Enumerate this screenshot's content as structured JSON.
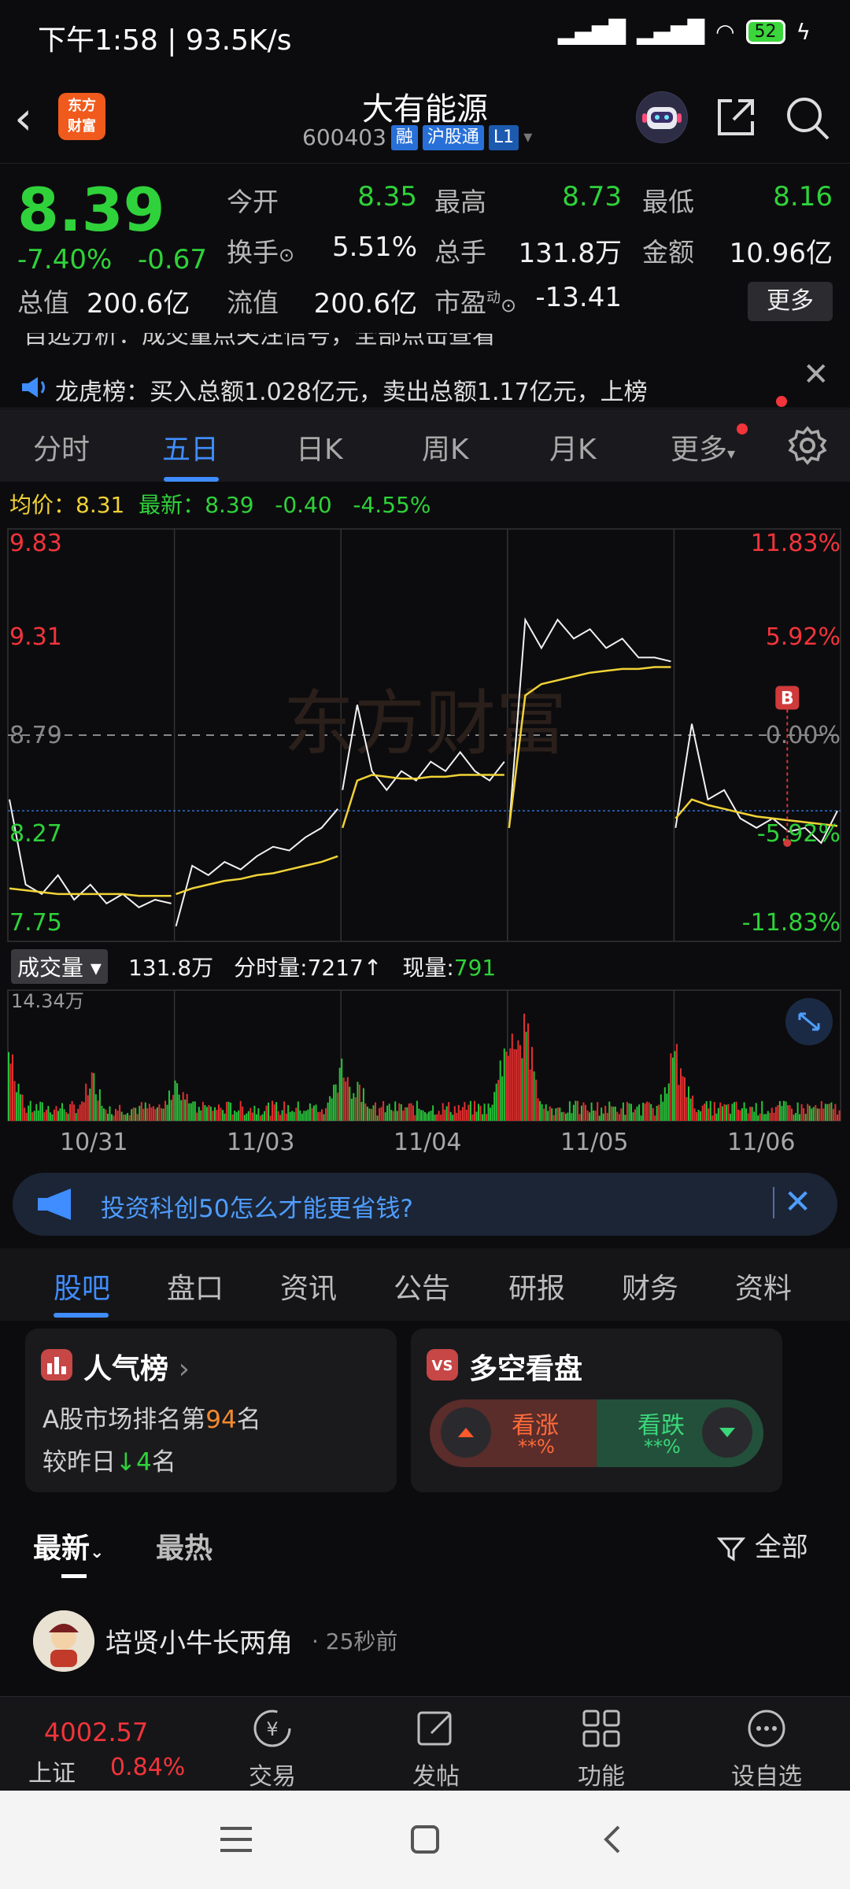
{
  "status_bar": {
    "text": "下午1:58 | 93.5K/s",
    "battery": "52"
  },
  "header": {
    "stock_name": "大有能源",
    "stock_code": "600403",
    "tags": [
      "融",
      "沪股通",
      "L1"
    ],
    "logo_text": "东方财富"
  },
  "quote": {
    "price": "8.39",
    "change_pct": "-7.40%",
    "change": "-0.67",
    "fields": [
      {
        "label": "今开",
        "value": "8.35",
        "color": "green"
      },
      {
        "label": "最高",
        "value": "8.73",
        "color": "green"
      },
      {
        "label": "最低",
        "value": "8.16",
        "color": "green"
      },
      {
        "label": "换手",
        "value": "5.51%",
        "color": "white"
      },
      {
        "label": "总手",
        "value": "131.8万",
        "color": "white"
      },
      {
        "label": "金额",
        "value": "10.96亿",
        "color": "white"
      },
      {
        "label": "总值",
        "value": "200.6亿",
        "color": "white"
      },
      {
        "label": "流值",
        "value": "200.6亿",
        "color": "white"
      },
      {
        "label": "市盈",
        "value": "-13.41",
        "color": "white"
      }
    ],
    "turnover_suffix": "⊙",
    "pe_superscript": "动",
    "more_label": "更多"
  },
  "notice": {
    "line1": "自选分析：成交量点关注信号，全部点击查看",
    "line2": "龙虎榜：买入总额1.028亿元，卖出总额1.17亿元，上榜"
  },
  "chart_tabs": [
    "分时",
    "五日",
    "日K",
    "周K",
    "月K",
    "更多"
  ],
  "avg_row": {
    "avg_label": "均价：",
    "avg_value": "8.31",
    "latest_label": "最新：",
    "latest_value": "8.39",
    "chg": "-0.40",
    "pct": "-4.55%"
  },
  "axis": {
    "left_labels": [
      "9.83",
      "9.31",
      "8.79",
      "8.27",
      "7.75"
    ],
    "right_labels": [
      "11.83%",
      "5.92%",
      "0.00%",
      "-5.92%",
      "-11.83%"
    ],
    "watermark": "东方财富",
    "marker": "B"
  },
  "chart_data": {
    "type": "line",
    "title": "",
    "x": [
      "10/31",
      "11/03",
      "11/04",
      "11/05",
      "11/06"
    ],
    "ylim": [
      7.75,
      9.83
    ],
    "reference": 8.79,
    "series": [
      {
        "values": [
          [
            8.45,
            8.0,
            7.95,
            8.05,
            7.92,
            8.0,
            7.9,
            7.95,
            7.88,
            7.92,
            7.9
          ],
          [
            7.78,
            8.1,
            8.05,
            8.12,
            8.08,
            8.15,
            8.2,
            8.18,
            8.25,
            8.3,
            8.4
          ],
          [
            8.5,
            8.95,
            8.6,
            8.5,
            8.6,
            8.55,
            8.65,
            8.6,
            8.7,
            8.6,
            8.55,
            8.65
          ],
          [
            8.3,
            9.4,
            9.25,
            9.4,
            9.3,
            9.35,
            9.25,
            9.3,
            9.2,
            9.2,
            9.18
          ],
          [
            8.3,
            8.85,
            8.45,
            8.5,
            8.35,
            8.3,
            8.35,
            8.28,
            8.3,
            8.22,
            8.39
          ]
        ]
      },
      {
        "values": [
          [
            7.98,
            7.97,
            7.96,
            7.95,
            7.95,
            7.95,
            7.95,
            7.95,
            7.94,
            7.94,
            7.94
          ],
          [
            7.95,
            7.98,
            8.0,
            8.02,
            8.03,
            8.05,
            8.06,
            8.08,
            8.1,
            8.12,
            8.15
          ],
          [
            8.3,
            8.55,
            8.58,
            8.57,
            8.56,
            8.56,
            8.57,
            8.57,
            8.58,
            8.58,
            8.58,
            8.58
          ],
          [
            8.3,
            9.0,
            9.06,
            9.08,
            9.1,
            9.12,
            9.13,
            9.14,
            9.14,
            9.15,
            9.15
          ],
          [
            8.35,
            8.45,
            8.42,
            8.4,
            8.38,
            8.36,
            8.35,
            8.34,
            8.33,
            8.32,
            8.31
          ]
        ]
      }
    ]
  },
  "volume": {
    "select_label": "成交量",
    "total": "131.8万",
    "fenshi_label": "分时量:",
    "fenshi_value": "7217",
    "xianliang_label": "现量:",
    "xianliang_value": "791",
    "max_label": "14.34万"
  },
  "dates": [
    "10/31",
    "11/03",
    "11/04",
    "11/05",
    "11/06"
  ],
  "ad": {
    "text": "投资科创50怎么才能更省钱?"
  },
  "sub_tabs": [
    "股吧",
    "盘口",
    "资讯",
    "公告",
    "研报",
    "财务",
    "资料"
  ],
  "popularity": {
    "title": "人气榜",
    "rank_prefix": "A股市场排名第",
    "rank": "94",
    "rank_suffix": "名",
    "change_prefix": "较昨日",
    "change": "4",
    "change_suffix": "名"
  },
  "long_short": {
    "title": "多空看盘",
    "up_label": "看涨",
    "up_value": "**%",
    "down_label": "看跌",
    "down_value": "**%"
  },
  "feed": {
    "tab_latest": "最新",
    "tab_hot": "最热",
    "filter_label": "全部",
    "post_author": "培贤小牛长两角",
    "post_time": "· 25秒前"
  },
  "bottom_nav": {
    "index_value": "4002.57",
    "index_name": "上证",
    "index_pct": "0.84%",
    "items": [
      "交易",
      "发帖",
      "功能",
      "设自选"
    ]
  }
}
